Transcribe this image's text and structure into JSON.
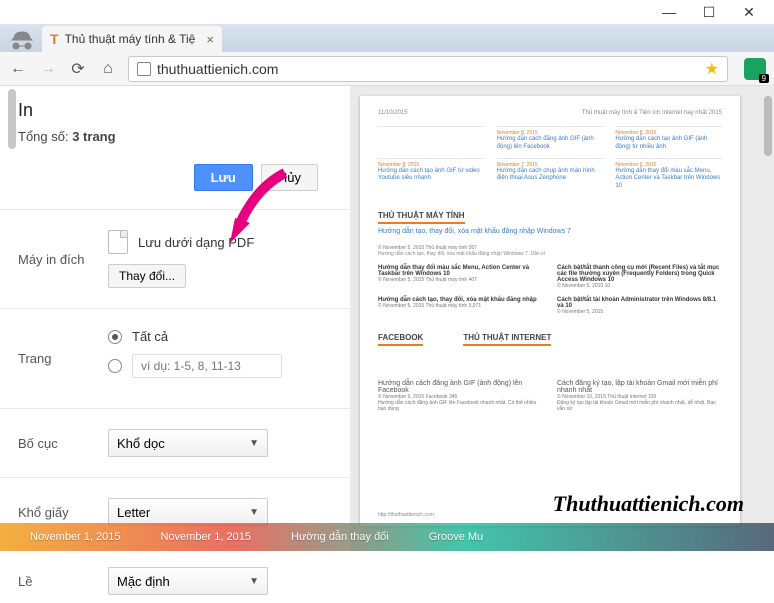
{
  "window": {
    "title": "Thủ thuật máy tính & Tiệ"
  },
  "nav": {
    "url": "thuthuattienich.com"
  },
  "print": {
    "heading": "In",
    "total_label": "Tổng số:",
    "total_pages": "3 trang",
    "save_btn": "Lưu",
    "cancel_btn": "Hủy",
    "dest_label": "Máy in đích",
    "dest_value": "Lưu dưới dạng PDF",
    "change_btn": "Thay đổi...",
    "pages_label": "Trang",
    "pages_all": "Tất cả",
    "pages_range_ph": "ví dụ: 1-5, 8, 11-13",
    "layout_label": "Bố cục",
    "layout_value": "Khổ dọc",
    "papersize_label": "Khổ giấy",
    "papersize_value": "Letter",
    "margins_label": "Lề",
    "margins_value": "Mặc định"
  },
  "preview": {
    "page_date": "11/10/2015",
    "page_title": "Thủ thuật máy tính & Tiện ích Internet hay nhất 2015",
    "articles_r1": [
      {
        "date": "November 8, 2015",
        "title": "Hướng dẫn cách đăng ảnh GIF (ảnh động) lên Facebook"
      },
      {
        "date": "November 8, 2015",
        "title": "Hướng dẫn cách tạo ảnh GIF (ảnh động) từ nhiều ảnh"
      }
    ],
    "articles_r2": [
      {
        "date": "November 8, 2015",
        "title": "Hướng dẫn cách tạo ảnh GIF từ video Youtube siêu nhanh"
      },
      {
        "date": "November 7, 2015",
        "title": "Hướng dẫn cách chụp ảnh màn hình điện thoại Asus Zenphone"
      },
      {
        "date": "November 6, 2015",
        "title": "Hướng dẫn thay đổi màu sắc Menu, Action Center và Taskbar trên Windows 10"
      }
    ],
    "sec1": "THỦ THUẬT MÁY TÍNH",
    "main_art": "Hướng dẫn tạo, thay đổi, xóa mật khẩu đăng nhập Windows 7",
    "main_meta": "© November 5, 2015  Thủ thuật máy tính  267",
    "main_sub": "Hướng dẫn cách tạo, thay đổi, xóa mật khẩu đăng nhập Windows 7. Dẫn ví",
    "list": [
      {
        "t": "Hướng dẫn thay đổi màu sắc Menu, Action Center và Taskbar trên Windows 10",
        "m": "© November 5, 2015  Thủ thuật máy tính  407"
      },
      {
        "t": "Cách bật/tắt thanh công cụ mới (Recent Files) và tắt mục các file thường xuyên (Frequently Folders) trong Quick Access Windows 10",
        "m": "© November 5, 2015  10"
      },
      {
        "t": "Hướng dẫn cách tạo, thay đổi, xóa mật khẩu đăng nhập",
        "m": "© November 5, 2015  Thủ thuật máy tính  5,971"
      },
      {
        "t": "Cách bật/tắt tài khoản Administrator trên Windows 8/8.1 và 10",
        "m": "© November 5, 2015"
      }
    ],
    "sec2a": "FACEBOOK",
    "sec2b": "THỦ THUẬT INTERNET",
    "fb_art": {
      "t": "Hướng dẫn cách đăng ảnh GIF (ảnh động) lên Facebook",
      "m": "© November 9, 2015  Facebook  345"
    },
    "fb_sub": "Hướng dẫn cách đăng ảnh GIF lên Facebook nhanh nhất. Có thể nhiều bạn dùng",
    "net_art": {
      "t": "Cách đăng ký tạo, lập tài khoản Gmail mới miễn phí nhanh nhất",
      "m": "© November 10, 2015  Thủ thuật internet  109"
    },
    "net_sub": "Đăng ký tạo lập tài khoản Gmail mới miễn phí nhanh nhất, dễ nhất. Bạn vẫn sử",
    "footer_url": "http://thuthuattienich.com"
  },
  "watermark": "Thuthuattienich.com",
  "strip": [
    "November 1, 2015",
    "November 1, 2015",
    "Hường dẫn thay đổi",
    "Groove Mu"
  ]
}
